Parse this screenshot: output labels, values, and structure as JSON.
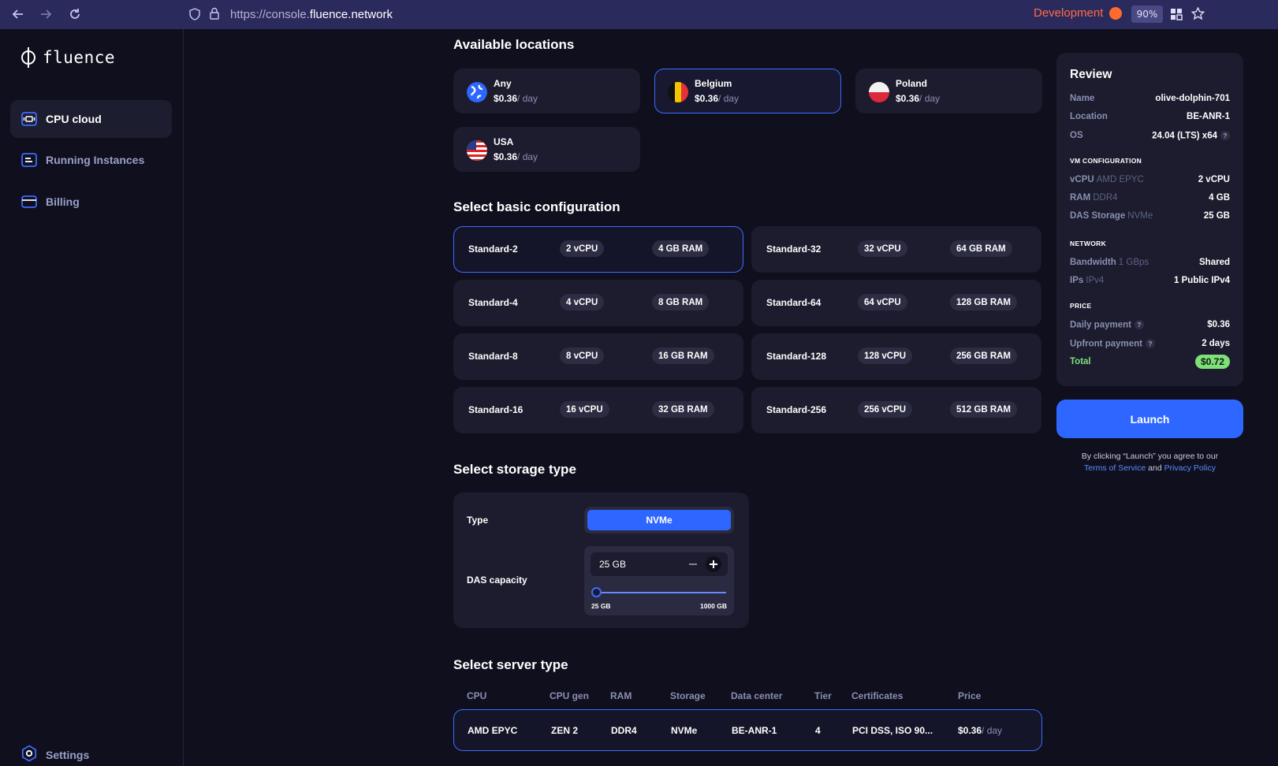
{
  "browser": {
    "url_prefix": "https://console.",
    "url_host": "fluence.network",
    "profile_label": "Development",
    "zoom": "90%"
  },
  "sidebar": {
    "logo_text": "fluence",
    "items": [
      {
        "label": "CPU cloud",
        "active": true
      },
      {
        "label": "Running Instances",
        "active": false
      },
      {
        "label": "Billing",
        "active": false
      }
    ],
    "settings_label": "Settings"
  },
  "locations": {
    "title": "Available locations",
    "price_unit": "/ day",
    "items": [
      {
        "name": "Any",
        "price": "$0.36",
        "selected": false
      },
      {
        "name": "Belgium",
        "price": "$0.36",
        "selected": true
      },
      {
        "name": "Poland",
        "price": "$0.36",
        "selected": false
      },
      {
        "name": "USA",
        "price": "$0.36",
        "selected": false
      }
    ]
  },
  "config": {
    "title": "Select basic configuration",
    "items": [
      {
        "name": "Standard-2",
        "cpu": "2 vCPU",
        "ram": "4 GB RAM",
        "selected": true
      },
      {
        "name": "Standard-32",
        "cpu": "32 vCPU",
        "ram": "64 GB RAM",
        "selected": false
      },
      {
        "name": "Standard-4",
        "cpu": "4 vCPU",
        "ram": "8 GB RAM",
        "selected": false
      },
      {
        "name": "Standard-64",
        "cpu": "64 vCPU",
        "ram": "128 GB RAM",
        "selected": false
      },
      {
        "name": "Standard-8",
        "cpu": "8 vCPU",
        "ram": "16 GB RAM",
        "selected": false
      },
      {
        "name": "Standard-128",
        "cpu": "128 vCPU",
        "ram": "256 GB RAM",
        "selected": false
      },
      {
        "name": "Standard-16",
        "cpu": "16 vCPU",
        "ram": "32 GB RAM",
        "selected": false
      },
      {
        "name": "Standard-256",
        "cpu": "256 vCPU",
        "ram": "512 GB RAM",
        "selected": false
      }
    ]
  },
  "storage": {
    "title": "Select storage type",
    "type_label": "Type",
    "type_value": "NVMe",
    "capacity_label": "DAS capacity",
    "capacity_value": "25 GB",
    "slider_min": "25 GB",
    "slider_max": "1000 GB",
    "slider_level": 0
  },
  "server": {
    "title": "Select server type",
    "headers": [
      "CPU",
      "CPU gen",
      "RAM",
      "Storage",
      "Data center",
      "Tier",
      "Certificates",
      "Price"
    ],
    "row": {
      "cpu": "AMD EPYC",
      "cpu_gen": "ZEN 2",
      "ram": "DDR4",
      "storage": "NVMe",
      "datacenter": "BE-ANR-1",
      "tier": "4",
      "certificates": "PCI DSS, ISO 90...",
      "price": "$0.36",
      "price_unit": "/ day"
    }
  },
  "review": {
    "title": "Review",
    "name_key": "Name",
    "name_val": "olive-dolphin-701",
    "location_key": "Location",
    "location_val": "BE-ANR-1",
    "os_key": "OS",
    "os_val": "24.04 (LTS) x64",
    "vm_section": "VM CONFIGURATION",
    "vcpu_key": "vCPU",
    "vcpu_sub": "AMD EPYC",
    "vcpu_val": "2 vCPU",
    "ram_key": "RAM",
    "ram_sub": "DDR4",
    "ram_val": "4 GB",
    "das_key": "DAS Storage",
    "das_sub": "NVMe",
    "das_val": "25 GB",
    "network_section": "NETWORK",
    "bw_key": "Bandwidth",
    "bw_sub": "1 GBps",
    "bw_val": "Shared",
    "ips_key": "IPs",
    "ips_sub": "IPv4",
    "ips_val": "1 Public IPv4",
    "price_section": "PRICE",
    "daily_key": "Daily payment",
    "daily_val": "$0.36",
    "upfront_key": "Upfront payment",
    "upfront_val": "2 days",
    "total_key": "Total",
    "total_val": "$0.72",
    "help_glyph": "?"
  },
  "launch": {
    "label": "Launch",
    "terms_prefix": "By clicking “Launch” you agree to our",
    "terms_link": "Terms of Service",
    "terms_and": "and",
    "privacy_link": "Privacy Policy"
  },
  "colors": {
    "accent": "#2e67ff",
    "total_green": "#7fe07a",
    "dev_orange": "#ff6b4a"
  }
}
